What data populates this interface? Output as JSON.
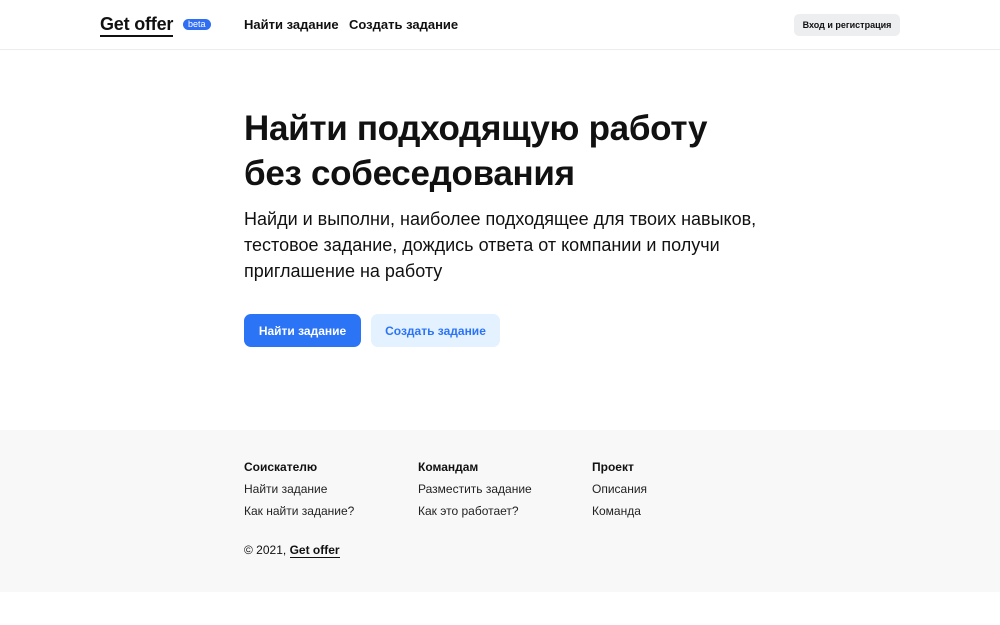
{
  "header": {
    "logo": "Get offer",
    "badge": "beta",
    "nav": [
      "Найти задание",
      "Создать задание"
    ],
    "login_label": "Вход и регистрация"
  },
  "hero": {
    "title_line1": "Найти подходящую работу",
    "title_line2": "без собеседования",
    "subtitle_line1": "Найди и выполни, наиболее подходящее для твоих навыков,",
    "subtitle_line2": "тестовое задание, дождись ответа от компании и получи",
    "subtitle_line3": "приглашение на работу",
    "primary_button": "Найти задание",
    "secondary_button": "Создать задание"
  },
  "footer": {
    "columns": [
      {
        "heading": "Соискателю",
        "links": [
          "Найти задание",
          "Как найти задание?"
        ]
      },
      {
        "heading": "Командам",
        "links": [
          "Разместить задание",
          "Как это работает?"
        ]
      },
      {
        "heading": "Проект",
        "links": [
          "Описания",
          "Команда"
        ]
      }
    ],
    "copyright_prefix": "© 2021,",
    "copyright_link": "Get offer"
  },
  "colors": {
    "accent": "#2c74f6",
    "accent_light": "#e4f1fe",
    "badge": "#2f6df2",
    "footer_bg": "#f8f8f8",
    "login_bg": "#edeef0"
  }
}
